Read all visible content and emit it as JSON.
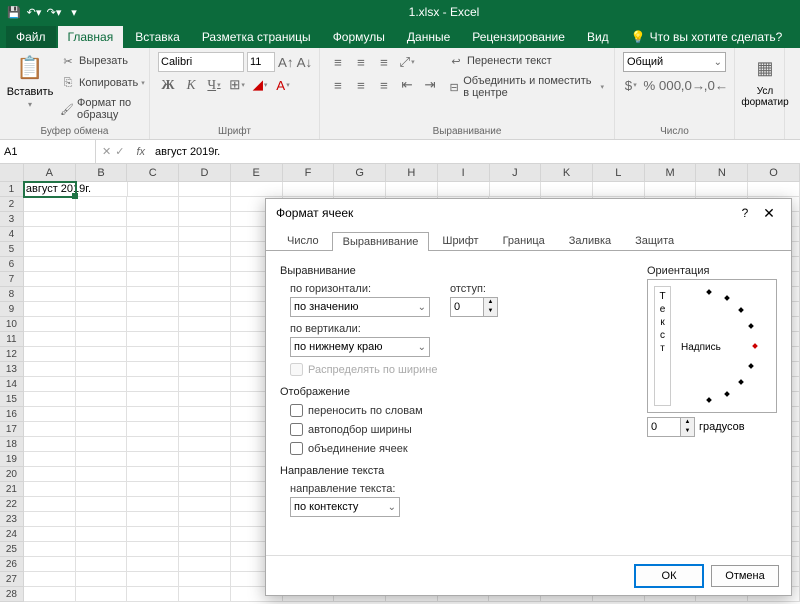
{
  "titlebar": {
    "title": "1.xlsx - Excel"
  },
  "tabs": {
    "file": "Файл",
    "home": "Главная",
    "insert": "Вставка",
    "layout": "Разметка страницы",
    "formulas": "Формулы",
    "data": "Данные",
    "review": "Рецензирование",
    "view": "Вид",
    "tell": "Что вы хотите сделать?"
  },
  "ribbon": {
    "paste": "Вставить",
    "cut": "Вырезать",
    "copy": "Копировать",
    "format_painter": "Формат по образцу",
    "clipboard_label": "Буфер обмена",
    "font_name": "Calibri",
    "font_size": "11",
    "font_label": "Шрифт",
    "wrap": "Перенести текст",
    "merge": "Объединить и поместить в центре",
    "align_label": "Выравнивание",
    "number_format": "Общий",
    "number_label": "Число",
    "cond_fmt": "Усл форматир"
  },
  "formula_bar": {
    "name": "A1",
    "value": "август 2019г."
  },
  "grid": {
    "cols": [
      "A",
      "B",
      "C",
      "D",
      "E",
      "F",
      "G",
      "H",
      "I",
      "J",
      "K",
      "L",
      "M",
      "N",
      "O"
    ],
    "A1": "август 2019г."
  },
  "dialog": {
    "title": "Формат ячеек",
    "tabs": [
      "Число",
      "Выравнивание",
      "Шрифт",
      "Граница",
      "Заливка",
      "Защита"
    ],
    "active_tab": 1,
    "section_align": "Выравнивание",
    "h_label": "по горизонтали:",
    "h_value": "по значению",
    "indent_label": "отступ:",
    "indent_value": "0",
    "v_label": "по вертикали:",
    "v_value": "по нижнему краю",
    "distribute": "Распределять по ширине",
    "section_display": "Отображение",
    "wrap_words": "переносить по словам",
    "autofit": "автоподбор ширины",
    "merge_cells": "объединение ячеек",
    "section_dir": "Направление текста",
    "textdir_label": "направление текста:",
    "textdir_value": "по контексту",
    "orient_label": "Ориентация",
    "orient_text": "Текст",
    "orient_caption": "Надпись",
    "degrees_value": "0",
    "degrees_label": "градусов",
    "ok": "ОК",
    "cancel": "Отмена"
  }
}
